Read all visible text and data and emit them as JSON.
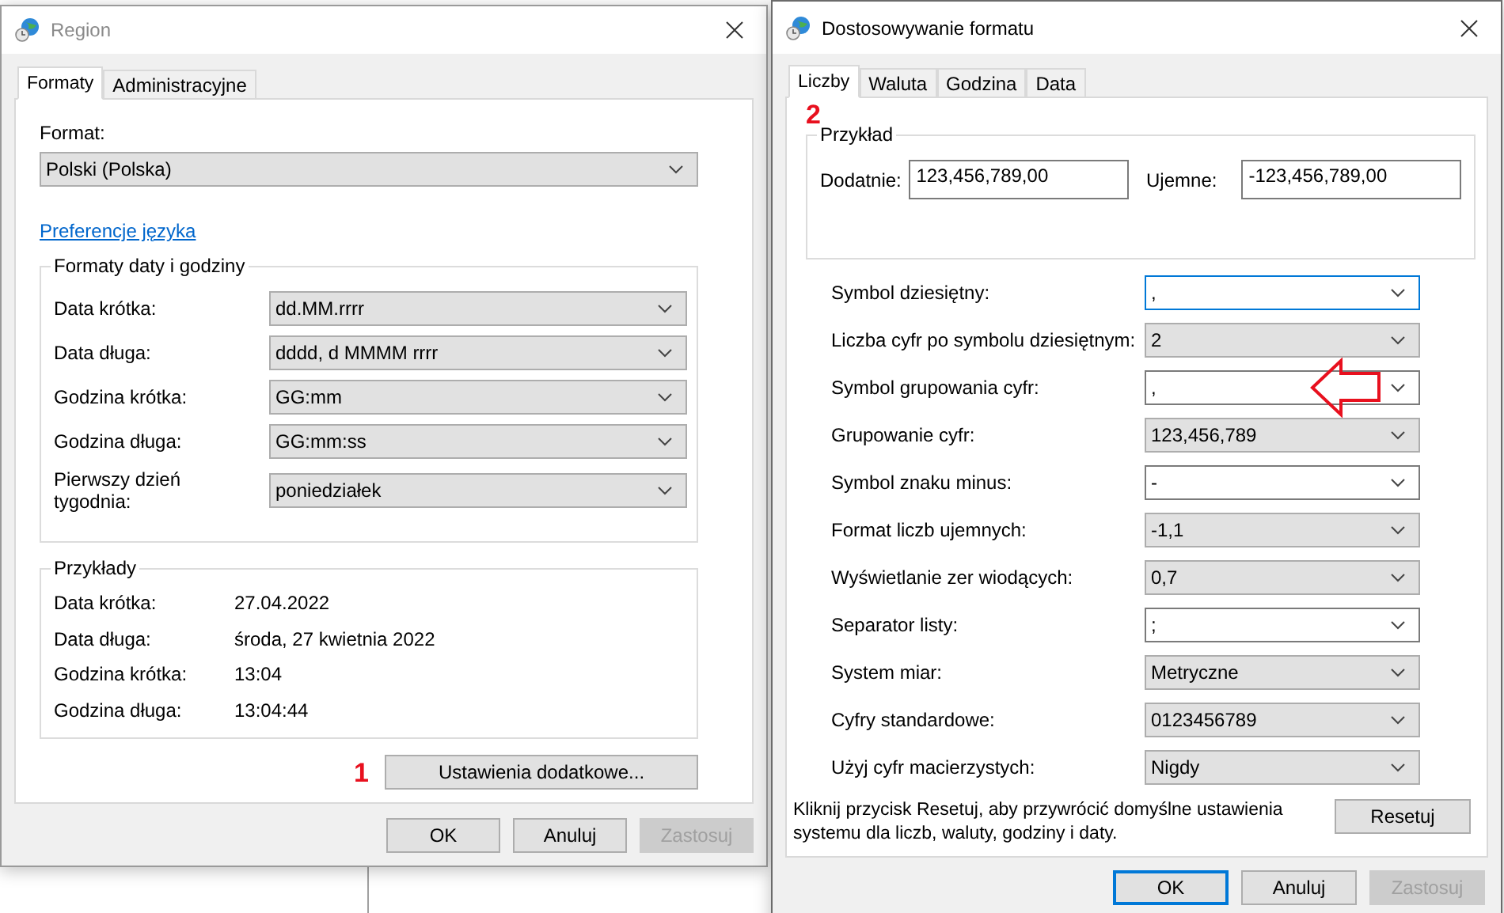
{
  "region_window": {
    "title": "Region",
    "tabs": [
      {
        "label": "Formaty",
        "selected": true
      },
      {
        "label": "Administracyjne",
        "selected": false
      }
    ],
    "format_label": "Format:",
    "format_value": "Polski (Polska)",
    "language_link": "Preferencje języka",
    "date_time_group": {
      "title": "Formaty daty i godziny",
      "rows": [
        {
          "label": "Data krótka:",
          "value": "dd.MM.rrrr"
        },
        {
          "label": "Data długa:",
          "value": "dddd, d MMMM rrrr"
        },
        {
          "label": "Godzina krótka:",
          "value": "GG:mm"
        },
        {
          "label": "Godzina długa:",
          "value": "GG:mm:ss"
        },
        {
          "label": "Pierwszy dzień tygodnia:",
          "value": "poniedziałek"
        }
      ]
    },
    "examples_group": {
      "title": "Przykłady",
      "rows": [
        {
          "label": "Data krótka:",
          "value": "27.04.2022"
        },
        {
          "label": "Data długa:",
          "value": "środa, 27 kwietnia 2022"
        },
        {
          "label": "Godzina krótka:",
          "value": "13:04"
        },
        {
          "label": "Godzina długa:",
          "value": "13:04:44"
        }
      ]
    },
    "annotation": "1",
    "more_button": "Ustawienia dodatkowe...",
    "buttons": [
      {
        "label": "OK",
        "disabled": false,
        "default": false
      },
      {
        "label": "Anuluj",
        "disabled": false,
        "default": false
      },
      {
        "label": "Zastosuj",
        "disabled": true,
        "default": false
      }
    ]
  },
  "customize_window": {
    "title": "Dostosowywanie formatu",
    "tabs": [
      {
        "label": "Liczby",
        "selected": true
      },
      {
        "label": "Waluta",
        "selected": false
      },
      {
        "label": "Godzina",
        "selected": false
      },
      {
        "label": "Data",
        "selected": false
      }
    ],
    "annotation": "2",
    "sample_group": {
      "title": "Przykład",
      "positive_label": "Dodatnie:",
      "positive_value": "123,456,789,00",
      "negative_label": "Ujemne:",
      "negative_value": "-123,456,789,00"
    },
    "settings": [
      {
        "label": "Symbol dziesiętny:",
        "value": ",",
        "kind": "edit",
        "focused": true,
        "marked": false
      },
      {
        "label": "Liczba cyfr po symbolu dziesiętnym:",
        "value": "2",
        "kind": "list",
        "focused": false,
        "marked": false
      },
      {
        "label": "Symbol grupowania cyfr:",
        "value": ",",
        "kind": "edit",
        "focused": false,
        "marked": true
      },
      {
        "label": "Grupowanie cyfr:",
        "value": "123,456,789",
        "kind": "list",
        "focused": false,
        "marked": false
      },
      {
        "label": "Symbol znaku minus:",
        "value": "-",
        "kind": "edit",
        "focused": false,
        "marked": false
      },
      {
        "label": "Format liczb ujemnych:",
        "value": "-1,1",
        "kind": "list",
        "focused": false,
        "marked": false
      },
      {
        "label": "Wyświetlanie zer wiodących:",
        "value": "0,7",
        "kind": "list",
        "focused": false,
        "marked": false
      },
      {
        "label": "Separator listy:",
        "value": ";",
        "kind": "edit",
        "focused": false,
        "marked": false
      },
      {
        "label": "System miar:",
        "value": "Metryczne",
        "kind": "list",
        "focused": false,
        "marked": false
      },
      {
        "label": "Cyfry standardowe:",
        "value": "0123456789",
        "kind": "list",
        "focused": false,
        "marked": false
      },
      {
        "label": "Użyj cyfr macierzystych:",
        "value": "Nigdy",
        "kind": "list",
        "focused": false,
        "marked": false
      }
    ],
    "note": "Kliknij przycisk Resetuj, aby przywrócić domyślne ustawienia systemu dla liczb, waluty, godziny i daty.",
    "reset_button": "Resetuj",
    "buttons": [
      {
        "label": "OK",
        "disabled": false,
        "default": true
      },
      {
        "label": "Anuluj",
        "disabled": false,
        "default": false
      },
      {
        "label": "Zastosuj",
        "disabled": true,
        "default": false
      }
    ]
  }
}
